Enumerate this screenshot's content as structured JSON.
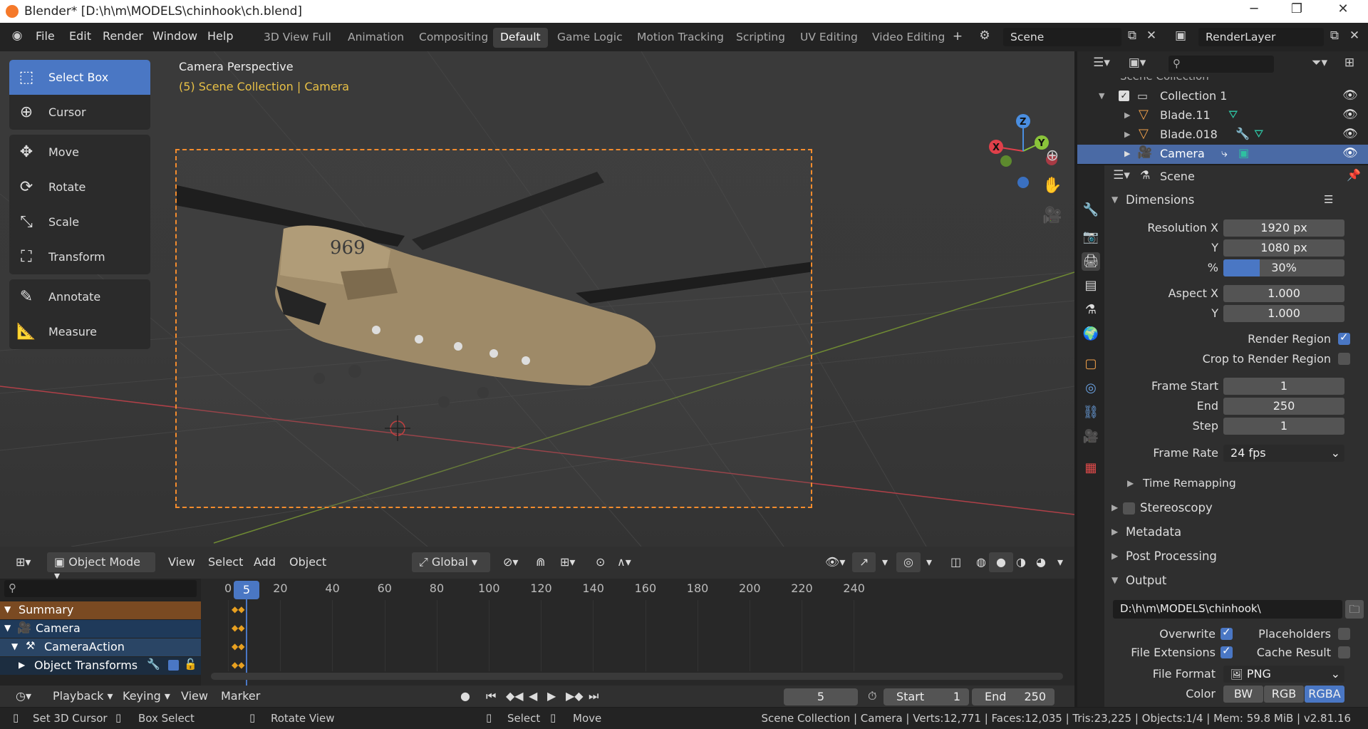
{
  "window": {
    "title": "Blender* [D:\\h\\m\\MODELS\\chinhook\\ch.blend]",
    "minimize": "─",
    "restore": "❐",
    "close": "✕"
  },
  "menu": [
    "File",
    "Edit",
    "Render",
    "Window",
    "Help"
  ],
  "workspaces": [
    "3D View Full",
    "Animation",
    "Compositing",
    "Default",
    "Game Logic",
    "Motion Tracking",
    "Scripting",
    "UV Editing",
    "Video Editing"
  ],
  "active_workspace": "Default",
  "add_tab": "+",
  "scene_field": "Scene",
  "renderlayer_field": "RenderLayer",
  "tools": [
    {
      "label": "Select Box",
      "icon": "select-box-icon",
      "glyph": "⬚",
      "active": true
    },
    {
      "label": "Cursor",
      "icon": "cursor-icon",
      "glyph": "⊕"
    },
    {
      "label": "Move",
      "icon": "move-icon",
      "glyph": "✥"
    },
    {
      "label": "Rotate",
      "icon": "rotate-icon",
      "glyph": "⟳"
    },
    {
      "label": "Scale",
      "icon": "scale-icon",
      "glyph": "⤡"
    },
    {
      "label": "Transform",
      "icon": "transform-icon",
      "glyph": "⛶"
    },
    {
      "label": "Annotate",
      "icon": "annotate-icon",
      "glyph": "✎"
    },
    {
      "label": "Measure",
      "icon": "measure-icon",
      "glyph": "📐"
    }
  ],
  "viewport": {
    "title": "Camera Perspective",
    "subtitle": "(5) Scene Collection | Camera",
    "model_number": "969"
  },
  "gizmo": {
    "x": "X",
    "y": "Y",
    "z": "Z"
  },
  "vp_header": {
    "mode": "Object Mode",
    "menus": [
      "View",
      "Select",
      "Add",
      "Object"
    ],
    "orientation": "Global"
  },
  "outliner": {
    "header_partial": "Scene Collection",
    "rows": [
      {
        "label": "Collection 1",
        "icon": "collection-icon"
      },
      {
        "label": "Blade.11",
        "icon": "mesh-icon"
      },
      {
        "label": "Blade.018",
        "icon": "mesh-icon"
      },
      {
        "label": "Camera",
        "icon": "camera-icon",
        "selected": true
      }
    ]
  },
  "properties": {
    "context": "Scene",
    "dimensions": {
      "title": "Dimensions",
      "resolution_x_label": "Resolution X",
      "resolution_x": "1920 px",
      "resolution_y_label": "Y",
      "resolution_y": "1080 px",
      "percent_label": "%",
      "percent": "30%",
      "percent_fill": 0.3,
      "aspect_x_label": "Aspect X",
      "aspect_x": "1.000",
      "aspect_y_label": "Y",
      "aspect_y": "1.000",
      "render_region_label": "Render Region",
      "render_region": true,
      "crop_label": "Crop to Render Region",
      "crop": false,
      "frame_start_label": "Frame Start",
      "frame_start": "1",
      "end_label": "End",
      "end": "250",
      "step_label": "Step",
      "step": "1",
      "frame_rate_label": "Frame Rate",
      "frame_rate": "24 fps",
      "time_remapping": "Time Remapping"
    },
    "sections": [
      "Stereoscopy",
      "Metadata",
      "Post Processing"
    ],
    "output": {
      "title": "Output",
      "path": "D:\\h\\m\\MODELS\\chinhook\\",
      "overwrite_label": "Overwrite",
      "overwrite": true,
      "placeholders_label": "Placeholders",
      "placeholders": false,
      "file_ext_label": "File Extensions",
      "file_ext": true,
      "cache_label": "Cache Result",
      "cache": false,
      "file_format_label": "File Format",
      "file_format": "PNG",
      "color_label": "Color",
      "color_opts": [
        "BW",
        "RGB",
        "RGBA"
      ],
      "color_selected": "RGBA"
    }
  },
  "timeline": {
    "frame_ticks": [
      "0",
      "20",
      "40",
      "60",
      "80",
      "100",
      "120",
      "140",
      "160",
      "180",
      "200",
      "220",
      "240"
    ],
    "current_frame": "5",
    "channels": [
      {
        "label": "Summary",
        "type": "summary"
      },
      {
        "label": "Camera",
        "type": "object"
      },
      {
        "label": "CameraAction",
        "type": "action"
      },
      {
        "label": "Object Transforms",
        "type": "group"
      }
    ]
  },
  "playback": {
    "menus": [
      "Playback",
      "Keying",
      "View",
      "Marker"
    ],
    "frame": "5",
    "start_label": "Start",
    "start": "1",
    "end_label": "End",
    "end": "250"
  },
  "status": {
    "items": [
      {
        "label": "Set 3D Cursor",
        "icon": "mouse-left-icon"
      },
      {
        "label": "Box Select",
        "icon": "mouse-drag-icon"
      },
      {
        "label": "Rotate View",
        "icon": "mouse-middle-icon"
      },
      {
        "label": "Select",
        "icon": "mouse-left-icon"
      },
      {
        "label": "Move",
        "icon": "mouse-drag-icon"
      }
    ],
    "stats": "Scene Collection | Camera | Verts:12,771 | Faces:12,035 | Tris:23,225 | Objects:1/4 | Mem: 59.8 MiB | v2.81.16"
  },
  "colors": {
    "accent": "#4a77c4",
    "camera_frame": "#f48c2d",
    "x_axis": "#e0404a",
    "y_axis": "#8ac43a",
    "z_axis": "#4a8ee0"
  }
}
